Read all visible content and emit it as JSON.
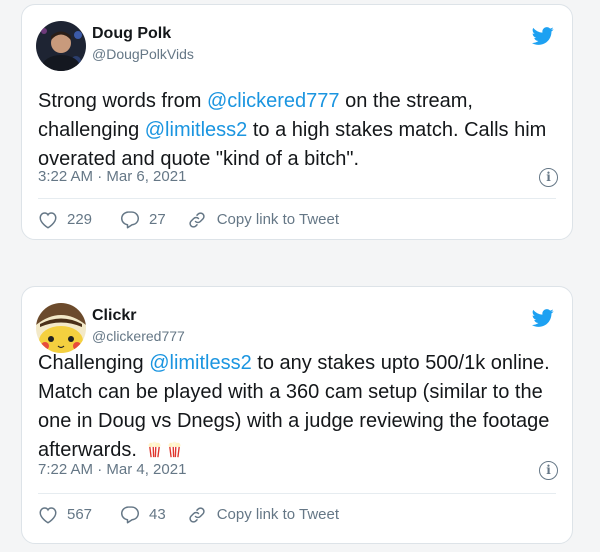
{
  "tweets": [
    {
      "name": "Doug Polk",
      "handle": "@DougPolkVids",
      "text_parts": [
        "Strong words from ",
        "@clickered777",
        " on the stream, challenging ",
        "@limitless2",
        " to a high stakes match. Calls him overated and quote \"kind of a bitch\"."
      ],
      "time": "3:22 AM · Mar 6, 2021",
      "likes": "229",
      "replies": "27",
      "copy_link": "Copy link to Tweet"
    },
    {
      "name": "Clickr",
      "handle": "@clickered777",
      "text_parts": [
        "Challenging ",
        "@limitless2",
        " to any stakes upto 500/1k online. Match can be played with a 360 cam setup (similar to the one in Doug vs Dnegs) with a judge reviewing the footage afterwards."
      ],
      "time": "7:22 AM · Mar 4, 2021",
      "likes": "567",
      "replies": "43",
      "copy_link": "Copy link to Tweet"
    }
  ],
  "colors": {
    "link": "#1b95e0",
    "muted": "#657786",
    "twitter_blue": "#1da1f2"
  },
  "icons": [
    "twitter-bird-icon",
    "info-icon",
    "heart-icon",
    "reply-icon",
    "link-icon",
    "popcorn-emoji"
  ]
}
